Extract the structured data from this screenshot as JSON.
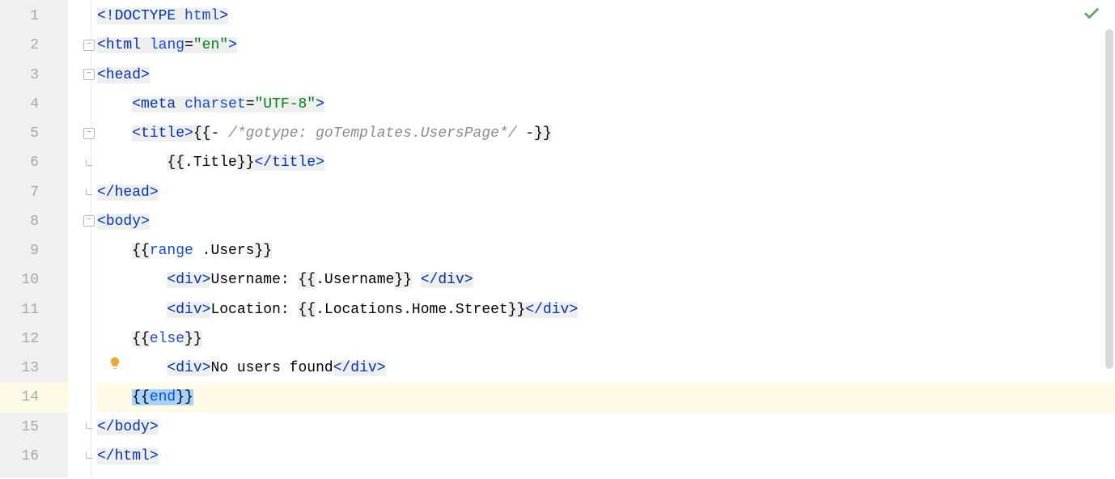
{
  "lineNumbers": [
    "1",
    "2",
    "3",
    "4",
    "5",
    "6",
    "7",
    "8",
    "9",
    "10",
    "11",
    "12",
    "13",
    "14",
    "15",
    "16"
  ],
  "code": {
    "l1": {
      "doctype": "<!DOCTYPE ",
      "html_kw": "html",
      "close": ">"
    },
    "l2": {
      "open": "<",
      "tag": "html",
      "sp": " ",
      "attr": "lang",
      "eq": "=",
      "val": "\"en\"",
      "close": ">"
    },
    "l3": {
      "open": "<",
      "tag": "head",
      "close": ">"
    },
    "l4": {
      "open": "<",
      "tag": "meta",
      "sp": " ",
      "attr": "charset",
      "eq": "=",
      "val": "\"UTF-8\"",
      "close": ">"
    },
    "l5": {
      "open": "<",
      "tag": "title",
      "close": ">",
      "d1": "{{",
      "dash1": "- ",
      "comment": "/*gotype: goTemplates.UsersPage*/",
      "dash2": " -",
      "d2": "}}"
    },
    "l6": {
      "d1": "{{",
      "field": ".Title",
      "d2": "}}",
      "copen": "</",
      "ctag": "title",
      "cclose": ">"
    },
    "l7": {
      "copen": "</",
      "ctag": "head",
      "cclose": ">"
    },
    "l8": {
      "open": "<",
      "tag": "body",
      "close": ">"
    },
    "l9": {
      "d1": "{{",
      "kw": "range",
      "sp": " ",
      "field": ".Users",
      "d2": "}}"
    },
    "l10": {
      "open": "<",
      "tag": "div",
      "close": ">",
      "text": "Username: ",
      "d1": "{{",
      "field": ".Username",
      "d2": "}}",
      "sp": " ",
      "copen": "</",
      "ctag": "div",
      "cclose": ">"
    },
    "l11": {
      "open": "<",
      "tag": "div",
      "close": ">",
      "text": "Location: ",
      "d1": "{{",
      "field": ".Locations.Home.Street",
      "d2": "}}",
      "copen": "</",
      "ctag": "div",
      "cclose": ">"
    },
    "l12": {
      "d1": "{{",
      "kw": "else",
      "d2": "}}"
    },
    "l13": {
      "open": "<",
      "tag": "div",
      "close": ">",
      "text": "No users found",
      "copen": "</",
      "ctag": "div",
      "cclose": ">"
    },
    "l14": {
      "d1": "{{",
      "kw": "end",
      "d2": "}}"
    },
    "l15": {
      "copen": "</",
      "ctag": "body",
      "cclose": ">"
    },
    "l16": {
      "copen": "</",
      "ctag": "html",
      "cclose": ">"
    }
  },
  "icons": {
    "check": "✓",
    "bulb": "💡"
  }
}
